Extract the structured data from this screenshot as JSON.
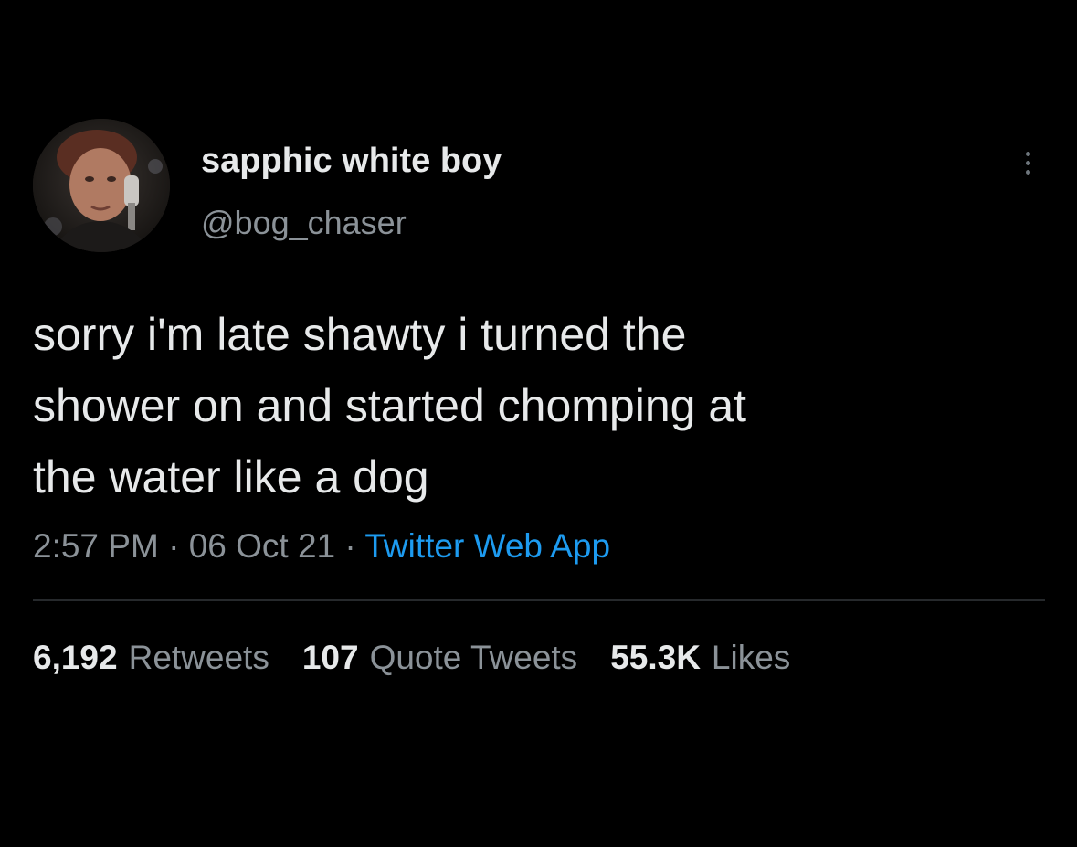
{
  "author": {
    "display_name": "sapphic white boy",
    "handle": "@bog_chaser"
  },
  "tweet": {
    "lines": [
      "sorry i'm late shawty i turned the",
      "shower on and started chomping at",
      "the water like a dog"
    ],
    "time": "2:57 PM",
    "date": "06 Oct 21",
    "separator": "·",
    "source": "Twitter Web App"
  },
  "stats": {
    "retweets": {
      "count": "6,192",
      "label": "Retweets"
    },
    "quote_tweets": {
      "count": "107",
      "label": "Quote Tweets"
    },
    "likes": {
      "count": "55.3K",
      "label": "Likes"
    }
  },
  "colors": {
    "background": "#000000",
    "text": "#e7e9ea",
    "secondary": "#8b9298",
    "link": "#1d9bf0",
    "divider": "#26292c"
  },
  "icons": {
    "more": "more-vertical-icon"
  }
}
